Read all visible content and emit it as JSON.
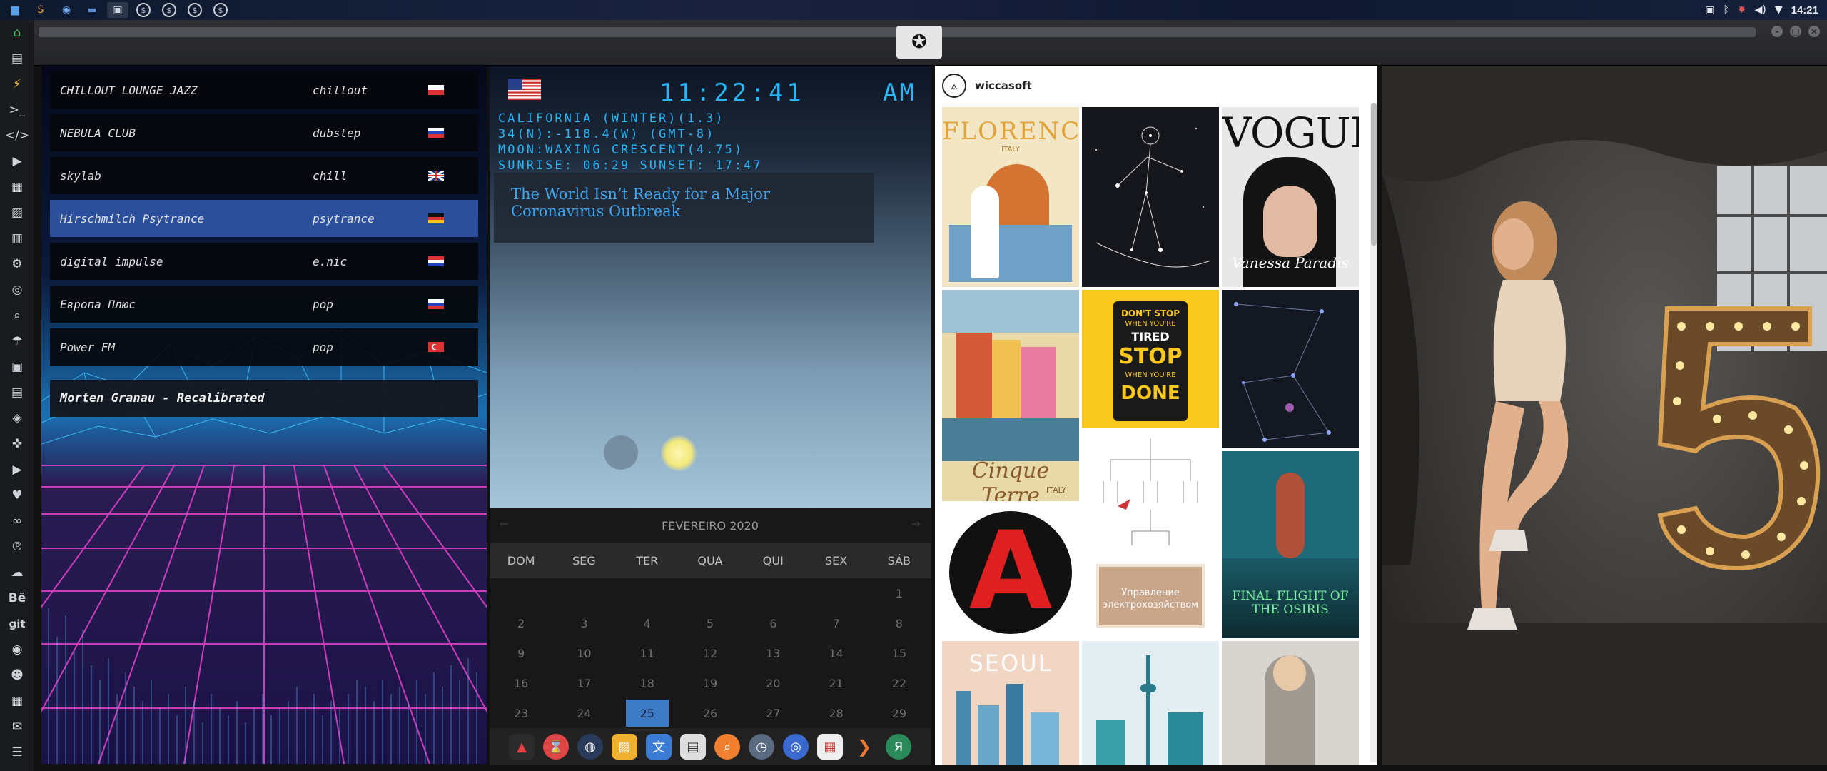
{
  "top_panel": {
    "launchers": [
      "files-icon",
      "sublime-icon",
      "chrome-icon",
      "folder-icon",
      "screen-icon",
      "dollar-1",
      "dollar-2",
      "dollar-3",
      "dollar-4"
    ],
    "clock": "14:21"
  },
  "radio": {
    "stations": [
      {
        "name": "CHILLOUT LOUNGE JAZZ",
        "genre": "chillout",
        "flag": "poland"
      },
      {
        "name": "NEBULA CLUB",
        "genre": "dubstep",
        "flag": "russia"
      },
      {
        "name": "skylab",
        "genre": "chill",
        "flag": "uk"
      },
      {
        "name": "Hirschmilch Psytrance",
        "genre": "psytrance",
        "flag": "germany",
        "selected": true
      },
      {
        "name": "digital impulse",
        "genre": "e.nic",
        "flag": "croatia"
      },
      {
        "name": "Европа Плюс",
        "genre": "pop",
        "flag": "russia"
      },
      {
        "name": "Power FM",
        "genre": "pop",
        "flag": "turkey"
      }
    ],
    "now_playing": "Morten Granau - Recalibrated"
  },
  "weather": {
    "time": "11:22:41",
    "ampm": "AM",
    "location": "CALIFORNIA (WINTER)(1.3)",
    "coords": "34(N):-118.4(W) (GMT-8)",
    "moon": "MOON:WAXING CRESCENT(4.75)",
    "sun": "SUNRISE: 06:29 SUNSET: 17:47",
    "news": "The World Isn’t Ready for a Major Coronavirus Outbreak"
  },
  "calendar": {
    "month": "FEVEREIRO 2020",
    "weekdays": [
      "DOM",
      "SEG",
      "TER",
      "QUA",
      "QUI",
      "SEX",
      "SÁB"
    ],
    "days": [
      "",
      "",
      "",
      "",
      "",
      "",
      "1",
      "2",
      "3",
      "4",
      "5",
      "6",
      "7",
      "8",
      "9",
      "10",
      "11",
      "12",
      "13",
      "14",
      "15",
      "16",
      "17",
      "18",
      "19",
      "20",
      "21",
      "22",
      "23",
      "24",
      "25",
      "26",
      "27",
      "28",
      "29"
    ],
    "today": "25"
  },
  "instagram": {
    "username": "wiccasoft",
    "tiles": {
      "florence": "FLORENCE",
      "florence_sub": "ITALY",
      "vogue": "VOGUE",
      "vogue_name": "Vanessa Paradis",
      "cinque": "Cinque Terre",
      "cinque_sub": "ITALY",
      "stop1": "DON'T STOP",
      "stop2": "WHEN YOU'RE",
      "stop3": "TIRED",
      "stop4": "STOP",
      "stop5": "WHEN YOU'RE",
      "stop6": "DONE",
      "book": "Управление электрохозяйством",
      "osiris": "FINAL FLIGHT OF THE OSIRIS",
      "seoul": "SEOUL"
    }
  },
  "colors": {
    "accent_blue": "#29b6f6",
    "selected_station": "#2b4f9a",
    "today": "#3d7bc6"
  }
}
